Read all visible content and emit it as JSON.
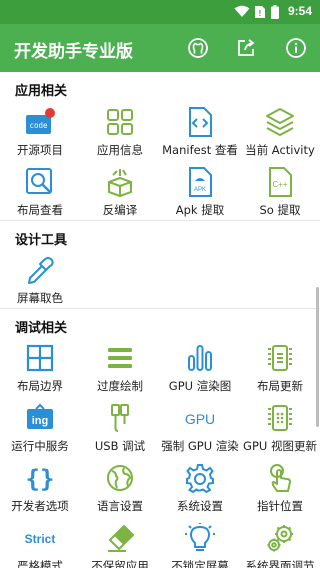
{
  "status_bar": {
    "time": "9:54"
  },
  "app_bar": {
    "title": "开发助手专业版",
    "actions": [
      "github-icon",
      "share-icon",
      "info-icon"
    ]
  },
  "sections": [
    {
      "title": "应用相关",
      "items": [
        {
          "label": "开源项目",
          "icon": "code-badge-icon"
        },
        {
          "label": "应用信息",
          "icon": "grid-icon"
        },
        {
          "label": "Manifest 查看",
          "icon": "file-code-icon"
        },
        {
          "label": "当前 Activity",
          "icon": "layers-icon"
        },
        {
          "label": "布局查看",
          "icon": "layout-search-icon"
        },
        {
          "label": "反编译",
          "icon": "gift-box-icon"
        },
        {
          "label": "Apk 提取",
          "icon": "apk-file-icon"
        },
        {
          "label": "So 提取",
          "icon": "cpp-file-icon"
        }
      ]
    },
    {
      "title": "设计工具",
      "items": [
        {
          "label": "屏幕取色",
          "icon": "eyedropper-icon"
        }
      ]
    },
    {
      "title": "调试相关",
      "items": [
        {
          "label": "布局边界",
          "icon": "layout-bounds-icon"
        },
        {
          "label": "过度绘制",
          "icon": "overdraw-icon"
        },
        {
          "label": "GPU 渲染图",
          "icon": "bar-chart-icon"
        },
        {
          "label": "布局更新",
          "icon": "layout-update-icon"
        },
        {
          "label": "运行中服务",
          "icon": "running-service-icon",
          "icon_text": "ing"
        },
        {
          "label": "USB 调试",
          "icon": "usb-icon"
        },
        {
          "label": "强制 GPU 渲染",
          "icon": "gpu-text-icon",
          "icon_text": "GPU"
        },
        {
          "label": "GPU 视图更新",
          "icon": "gpu-view-update-icon"
        },
        {
          "label": "开发者选项",
          "icon": "braces-icon"
        },
        {
          "label": "语言设置",
          "icon": "globe-icon"
        },
        {
          "label": "系统设置",
          "icon": "gear-icon"
        },
        {
          "label": "指针位置",
          "icon": "pointer-icon"
        },
        {
          "label": "严格模式",
          "icon": "strict-text-icon",
          "icon_text": "Strict"
        },
        {
          "label": "不保留应用",
          "icon": "eraser-icon"
        },
        {
          "label": "不锁定屏幕",
          "icon": "lightbulb-icon"
        },
        {
          "label": "系统界面调节",
          "icon": "gears-icon"
        }
      ]
    }
  ],
  "colors": {
    "primary": "#4caf50",
    "status_bar": "#3c9e3c",
    "icon_blue": "#2b8fd6",
    "icon_green": "#7cb342",
    "badge_red": "#e53935"
  }
}
